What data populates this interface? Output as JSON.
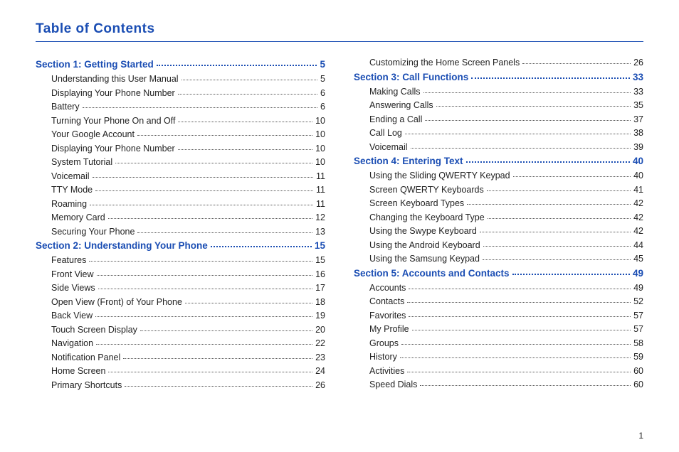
{
  "title": "Table of Contents",
  "page_number": "1",
  "left_column": [
    {
      "type": "section",
      "label": "Section 1:  Getting Started",
      "page": "5"
    },
    {
      "type": "item",
      "label": "Understanding this User Manual",
      "page": "5"
    },
    {
      "type": "item",
      "label": "Displaying Your Phone Number",
      "page": "6"
    },
    {
      "type": "item",
      "label": "Battery",
      "page": "6"
    },
    {
      "type": "item",
      "label": "Turning Your Phone On and Off",
      "page": "10"
    },
    {
      "type": "item",
      "label": "Your Google Account",
      "page": "10"
    },
    {
      "type": "item",
      "label": "Displaying Your Phone Number",
      "page": "10"
    },
    {
      "type": "item",
      "label": "System Tutorial",
      "page": "10"
    },
    {
      "type": "item",
      "label": "Voicemail",
      "page": "11"
    },
    {
      "type": "item",
      "label": "TTY Mode",
      "page": "11"
    },
    {
      "type": "item",
      "label": "Roaming",
      "page": "11"
    },
    {
      "type": "item",
      "label": "Memory Card",
      "page": "12"
    },
    {
      "type": "item",
      "label": "Securing Your Phone",
      "page": "13"
    },
    {
      "type": "section",
      "label": "Section 2:  Understanding Your Phone",
      "page": "15"
    },
    {
      "type": "item",
      "label": "Features",
      "page": "15"
    },
    {
      "type": "item",
      "label": "Front View",
      "page": "16"
    },
    {
      "type": "item",
      "label": "Side Views",
      "page": "17"
    },
    {
      "type": "item",
      "label": "Open View (Front) of Your Phone",
      "page": "18"
    },
    {
      "type": "item",
      "label": "Back View",
      "page": "19"
    },
    {
      "type": "item",
      "label": "Touch Screen Display",
      "page": "20"
    },
    {
      "type": "item",
      "label": "Navigation",
      "page": "22"
    },
    {
      "type": "item",
      "label": "Notification Panel",
      "page": "23"
    },
    {
      "type": "item",
      "label": "Home Screen",
      "page": "24"
    },
    {
      "type": "item",
      "label": "Primary Shortcuts",
      "page": "26"
    }
  ],
  "right_column": [
    {
      "type": "item",
      "label": "Customizing the Home Screen Panels",
      "page": "26"
    },
    {
      "type": "section",
      "label": "Section 3:  Call Functions",
      "page": "33"
    },
    {
      "type": "item",
      "label": "Making Calls",
      "page": "33"
    },
    {
      "type": "item",
      "label": "Answering Calls",
      "page": "35"
    },
    {
      "type": "item",
      "label": "Ending a Call",
      "page": "37"
    },
    {
      "type": "item",
      "label": "Call Log",
      "page": "38"
    },
    {
      "type": "item",
      "label": "Voicemail",
      "page": "39"
    },
    {
      "type": "section",
      "label": "Section 4:  Entering Text",
      "page": "40"
    },
    {
      "type": "item",
      "label": "Using the Sliding QWERTY Keypad",
      "page": "40"
    },
    {
      "type": "item",
      "label": "Screen QWERTY Keyboards",
      "page": "41"
    },
    {
      "type": "item",
      "label": "Screen Keyboard Types",
      "page": "42"
    },
    {
      "type": "item",
      "label": "Changing the Keyboard Type",
      "page": "42"
    },
    {
      "type": "item",
      "label": "Using the Swype Keyboard",
      "page": "42"
    },
    {
      "type": "item",
      "label": "Using the Android Keyboard",
      "page": "44"
    },
    {
      "type": "item",
      "label": "Using the Samsung Keypad",
      "page": "45"
    },
    {
      "type": "section",
      "label": "Section 5:  Accounts and Contacts",
      "page": "49"
    },
    {
      "type": "item",
      "label": "Accounts",
      "page": "49"
    },
    {
      "type": "item",
      "label": "Contacts",
      "page": "52"
    },
    {
      "type": "item",
      "label": "Favorites",
      "page": "57"
    },
    {
      "type": "item",
      "label": "My Profile",
      "page": "57"
    },
    {
      "type": "item",
      "label": "Groups",
      "page": "58"
    },
    {
      "type": "item",
      "label": "History",
      "page": "59"
    },
    {
      "type": "item",
      "label": "Activities",
      "page": "60"
    },
    {
      "type": "item",
      "label": "Speed Dials",
      "page": "60"
    }
  ]
}
